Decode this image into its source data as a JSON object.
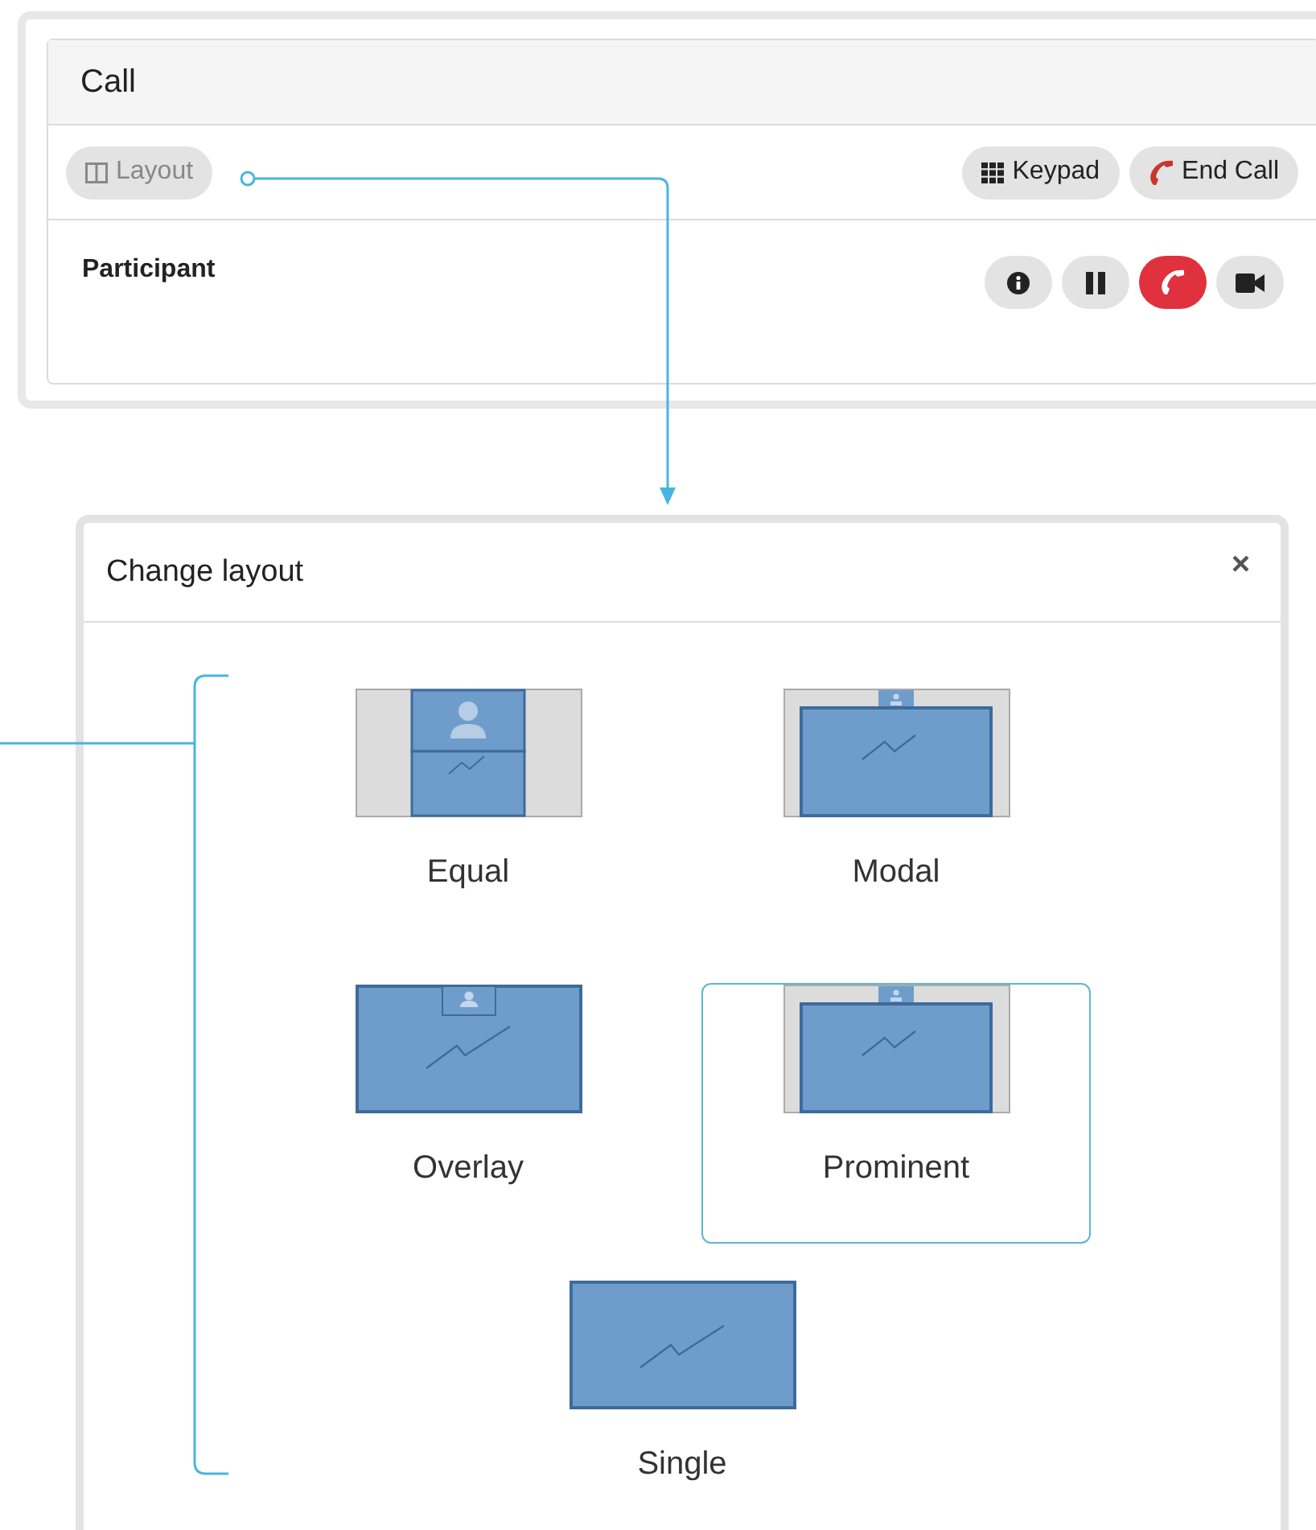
{
  "call_panel": {
    "title": "Call",
    "toolbar": [
      {
        "kind": "layout",
        "label": "Layout"
      },
      {
        "kind": "keypad",
        "label": "Keypad"
      },
      {
        "kind": "end-call",
        "label": "End Call"
      }
    ],
    "participant": {
      "name": "Participant",
      "actions": [
        {
          "kind": "info"
        },
        {
          "kind": "pause"
        },
        {
          "kind": "hangup"
        },
        {
          "kind": "video"
        }
      ]
    }
  },
  "dialog": {
    "title": "Change layout",
    "close": "×",
    "layouts": [
      {
        "kind": "equal",
        "label": "Equal",
        "selected": false
      },
      {
        "kind": "modal",
        "label": "Modal",
        "selected": false
      },
      {
        "kind": "overlay",
        "label": "Overlay",
        "selected": false
      },
      {
        "kind": "prominent",
        "label": "Prominent",
        "selected": true
      },
      {
        "kind": "single",
        "label": "Single",
        "selected": false
      }
    ]
  }
}
